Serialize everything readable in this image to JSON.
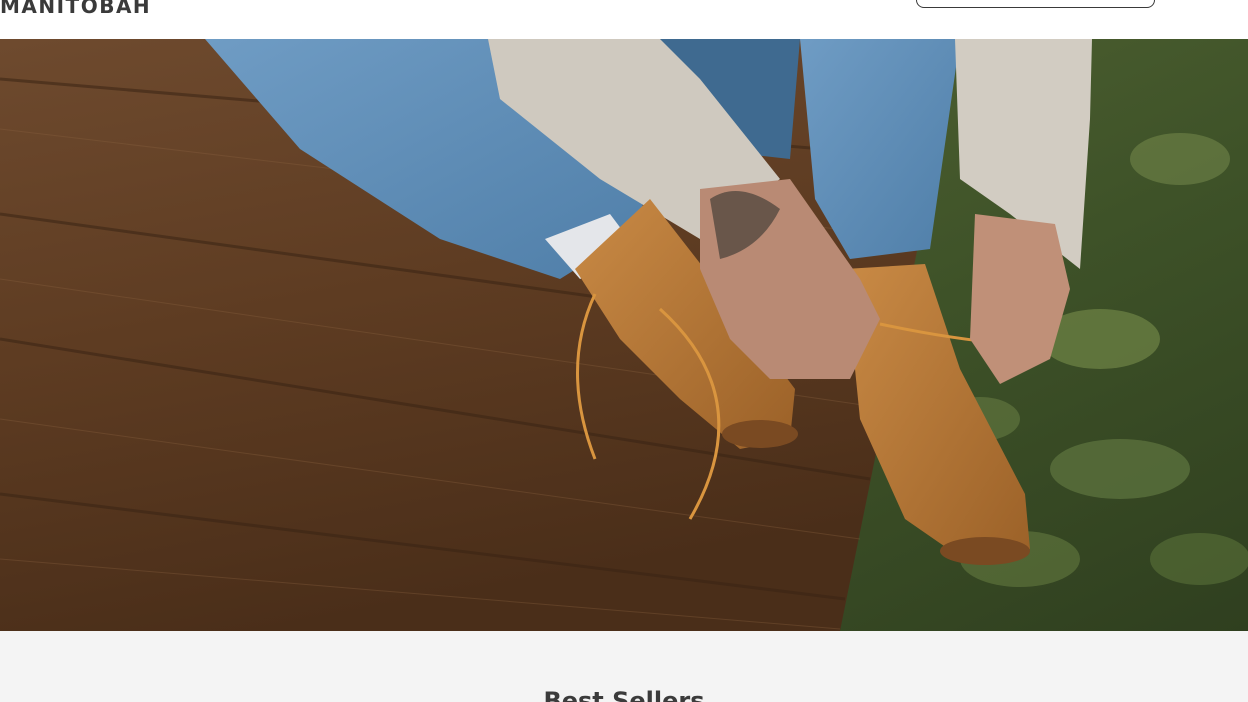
{
  "header": {
    "logo_text": "MANITOBAH",
    "search_placeholder": ""
  },
  "hero": {
    "image_alt": "Person lacing tan leather boots sitting on a wooden deck"
  },
  "best_sellers": {
    "title": "Best Sellers"
  },
  "colors": {
    "header_bg": "#ffffff",
    "section_bg": "#f4f4f4",
    "text_dark": "#3a3a3a"
  }
}
